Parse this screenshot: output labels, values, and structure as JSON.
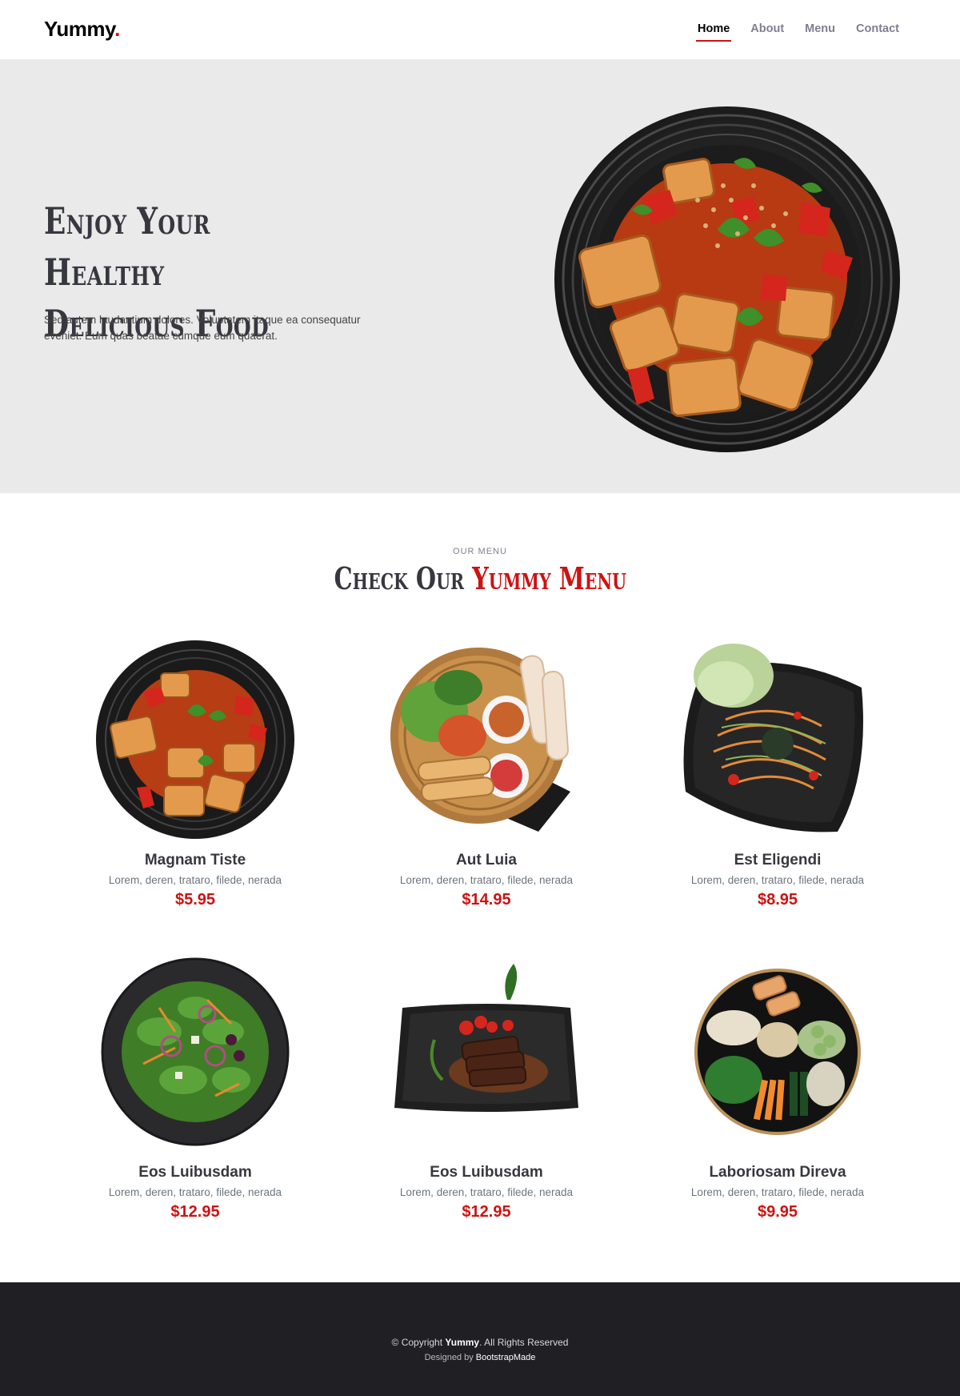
{
  "brand": {
    "name": "Yummy",
    "dot": ".",
    "accent": "#ce1212"
  },
  "nav": {
    "items": [
      {
        "label": "Home",
        "active": true
      },
      {
        "label": "About",
        "active": false
      },
      {
        "label": "Menu",
        "active": false
      },
      {
        "label": "Contact",
        "active": false
      }
    ]
  },
  "hero": {
    "title_line1": "Enjoy Your Healthy",
    "title_line2": "Delicious Food",
    "text": "Sed autem laudantium dolores. Voluptatem itaque ea consequatur eveniet. Eum quas beatae cumque eum quaerat.",
    "background": "#eaeaea"
  },
  "menu": {
    "subtitle": "Our Menu",
    "title_plain": "Check Our ",
    "title_accent": "Yummy Menu",
    "items": [
      {
        "name": "Magnam Tiste",
        "ingredients": "Lorem, deren, trataro, filede, nerada",
        "price": "$5.95",
        "image": "tofu-stirfry-bowl"
      },
      {
        "name": "Aut Luia",
        "ingredients": "Lorem, deren, trataro, filede, nerada",
        "price": "$14.95",
        "image": "spring-rolls-basket"
      },
      {
        "name": "Est Eligendi",
        "ingredients": "Lorem, deren, trataro, filede, nerada",
        "price": "$8.95",
        "image": "papaya-salad-plate"
      },
      {
        "name": "Eos Luibusdam",
        "ingredients": "Lorem, deren, trataro, filede, nerada",
        "price": "$12.95",
        "image": "green-salad-plate"
      },
      {
        "name": "Eos Luibusdam",
        "ingredients": "Lorem, deren, trataro, filede, nerada",
        "price": "$12.95",
        "image": "grilled-beef-slate"
      },
      {
        "name": "Laboriosam Direva",
        "ingredients": "Lorem, deren, trataro, filede, nerada",
        "price": "$9.95",
        "image": "poke-bowl"
      }
    ]
  },
  "footer": {
    "copyright_prefix": "© Copyright ",
    "copyright_brand": "Yummy",
    "copyright_suffix": ". All Rights Reserved",
    "designed_prefix": "Designed by ",
    "designed_link": "BootstrapMade"
  }
}
